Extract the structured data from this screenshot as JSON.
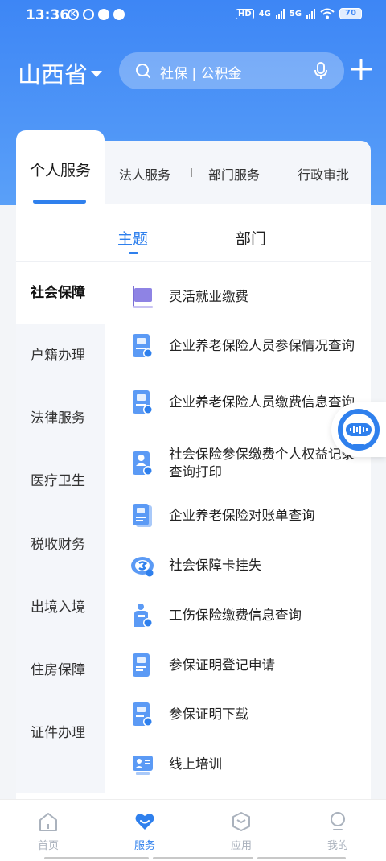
{
  "status_bar": {
    "time": "13:36",
    "left_icons": [
      "k-icon",
      "circle-icon",
      "weibo-icon",
      "compass-icon"
    ],
    "hd_label": "HD",
    "net_4g": "4G",
    "net_5g": "5G",
    "battery": "70"
  },
  "header": {
    "province": "山西省",
    "search_placeholder": "社保 | 公积金"
  },
  "tabs": [
    {
      "label": "个人服务",
      "active": true
    },
    {
      "label": "法人服务"
    },
    {
      "label": "部门服务"
    },
    {
      "label": "行政审批"
    }
  ],
  "subtabs": [
    {
      "label": "主题",
      "active": true
    },
    {
      "label": "部门"
    }
  ],
  "sidebar": [
    {
      "label": "社会保障",
      "active": true
    },
    {
      "label": "户籍办理"
    },
    {
      "label": "法律服务"
    },
    {
      "label": "医疗卫生"
    },
    {
      "label": "税收财务"
    },
    {
      "label": "出境入境"
    },
    {
      "label": "住房保障"
    },
    {
      "label": "证件办理"
    }
  ],
  "services": [
    {
      "label": "灵活就业缴费",
      "icon": "flag-icon"
    },
    {
      "label": "企业养老保险人员参保情况查询",
      "icon": "enterprise-doc-check-icon"
    },
    {
      "label": "企业养老保险人员缴费信息查询",
      "icon": "enterprise-doc-list-icon"
    },
    {
      "label": "社会保险参保缴费个人权益记录查询打印",
      "icon": "person-doc-icon"
    },
    {
      "label": "企业养老保险对账单查询",
      "icon": "statement-doc-icon"
    },
    {
      "label": "社会保障卡挂失",
      "icon": "social-card-icon"
    },
    {
      "label": "工伤保险缴费信息查询",
      "icon": "injury-insurance-icon"
    },
    {
      "label": "参保证明登记申请",
      "icon": "certificate-doc-icon"
    },
    {
      "label": "参保证明下载",
      "icon": "download-doc-icon"
    },
    {
      "label": "线上培训",
      "icon": "training-icon"
    }
  ],
  "bottom_nav": [
    {
      "label": "首页",
      "icon": "home-icon"
    },
    {
      "label": "服务",
      "icon": "heart-icon",
      "active": true
    },
    {
      "label": "应用",
      "icon": "apps-icon"
    },
    {
      "label": "我的",
      "icon": "profile-icon"
    }
  ],
  "colors": {
    "primary": "#2f80ed",
    "header_blue": "#3d86f5",
    "inactive_nav": "#aab2bd"
  }
}
